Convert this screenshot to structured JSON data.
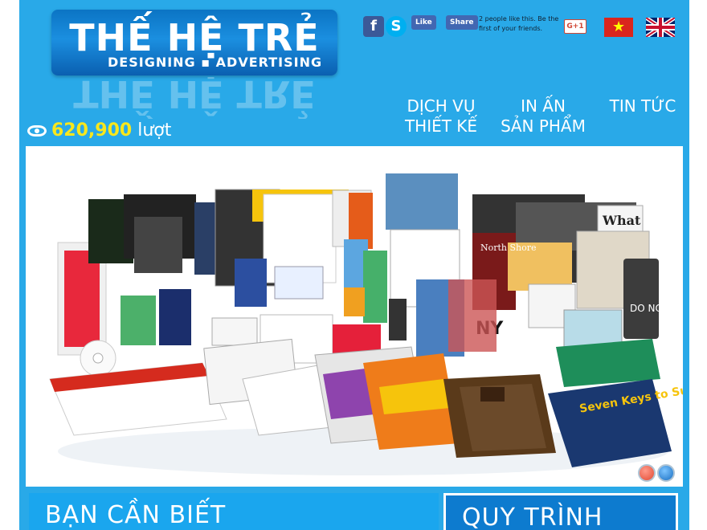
{
  "header": {
    "logo_title": "THẾ HỆ TRẺ",
    "logo_subtitle": "DESIGNING ▪ ADVERTISING",
    "social": {
      "facebook_icon": "f",
      "skype_icon": "S",
      "like_label": "Like",
      "share_label": "Share",
      "like_text": "2 people like this. Be the first of your friends.",
      "gplus_label": "G+1"
    },
    "languages": [
      "vietnamese-flag",
      "english-flag"
    ],
    "visits": {
      "count": "620,900",
      "unit": "lượt"
    }
  },
  "nav": {
    "items": [
      {
        "label_line1": "DỊCH VỤ",
        "label_line2": "THIẾT KẾ"
      },
      {
        "label_line1": "IN ẤN",
        "label_line2": "SẢN PHẨM"
      },
      {
        "label_line1": "TIN TỨC",
        "label_line2": ""
      }
    ]
  },
  "banner": {
    "image_text": {
      "what": "What",
      "do_not_disturb": "DO NOT DISTURB",
      "ny": "NY",
      "north_shore": "North Shore",
      "seven_keys": "Seven Keys to Success"
    },
    "slides_total": 2,
    "active_slide": 1
  },
  "panels": {
    "left_title": "BẠN CẦN BIẾT",
    "right_title": "QUY TRÌNH"
  },
  "colors": {
    "background": "#29a9e8",
    "accent_yellow": "#f8e71c",
    "logo_blue": "#0b74c4"
  }
}
